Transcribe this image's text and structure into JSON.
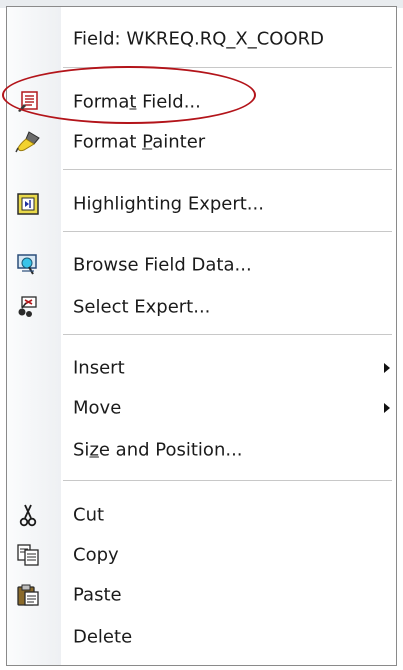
{
  "menu": {
    "field_header": "Field: WKREQ.RQ_X_COORD",
    "items": [
      {
        "label": "Format Field...",
        "mnemonic_index": 5,
        "icon": "format-field-icon"
      },
      {
        "label": "Format Painter",
        "mnemonic_index": 7,
        "icon": "format-painter-icon"
      },
      {
        "label": "Highlighting Expert...",
        "icon": "highlighting-expert-icon"
      },
      {
        "label": "Browse Field Data...",
        "icon": "browse-field-data-icon"
      },
      {
        "label": "Select Expert...",
        "icon": "select-expert-icon"
      },
      {
        "label": "Insert",
        "submenu": true
      },
      {
        "label": "Move",
        "submenu": true
      },
      {
        "label": "Size and Position...",
        "mnemonic_index": 2
      },
      {
        "label": "Cut",
        "icon": "scissors-icon"
      },
      {
        "label": "Copy",
        "icon": "copy-icon"
      },
      {
        "label": "Paste",
        "icon": "paste-icon"
      },
      {
        "label": "Delete"
      }
    ]
  },
  "colors": {
    "highlight_ellipse": "#b3141a",
    "menu_border": "#8a8a8a",
    "separator": "#c8c8c8"
  }
}
